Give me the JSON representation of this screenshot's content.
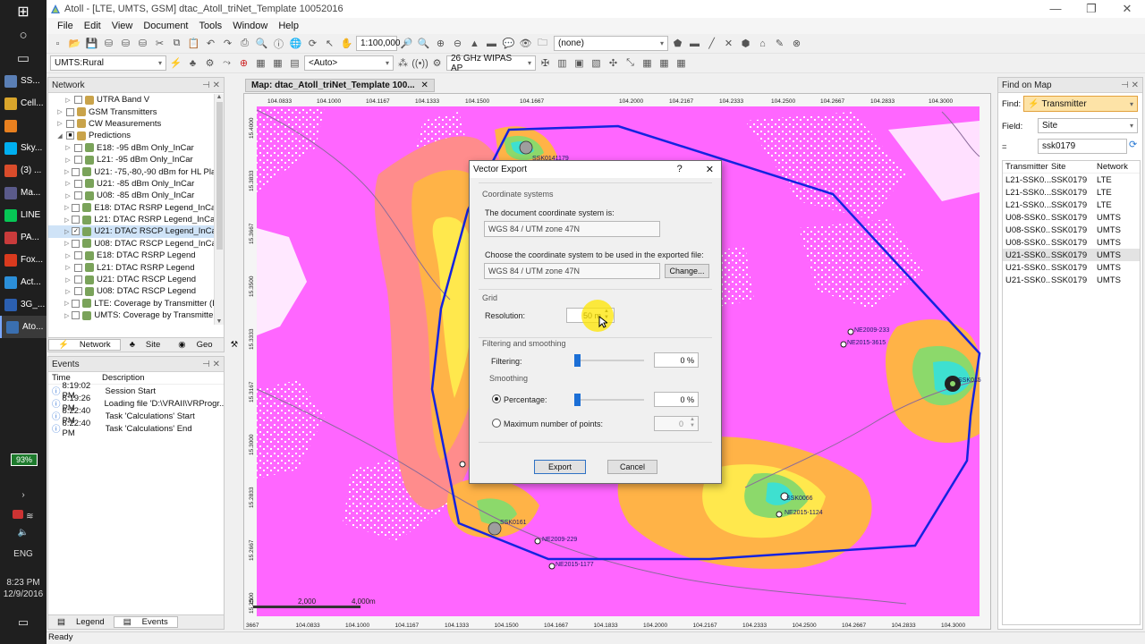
{
  "window": {
    "title": "Atoll - [LTE, UMTS, GSM] dtac_Atoll_triNet_Template 10052016"
  },
  "menu": [
    "File",
    "Edit",
    "View",
    "Document",
    "Tools",
    "Window",
    "Help"
  ],
  "toolbar1": {
    "scale": "1:100,000",
    "layer": "(none)"
  },
  "toolbar2": {
    "environment": "UMTS:Rural",
    "auto": "<Auto>",
    "frequency": "26 GHz WIPAS AP"
  },
  "taskbar": {
    "apps": [
      {
        "label": "SS...",
        "color": "#5a7fb5"
      },
      {
        "label": "Cell...",
        "color": "#d9a52b"
      },
      {
        "label": "",
        "color": "#e8801f"
      },
      {
        "label": "Sky...",
        "color": "#00aff0"
      },
      {
        "label": "(3) ...",
        "color": "#d94c2b"
      },
      {
        "label": "Ma...",
        "color": "#5a5a8a"
      },
      {
        "label": "LINE",
        "color": "#06c755"
      },
      {
        "label": "PA...",
        "color": "#c93b3b"
      },
      {
        "label": "Fox...",
        "color": "#d93a1e"
      },
      {
        "label": "Act...",
        "color": "#2b8fd9"
      },
      {
        "label": "3G_...",
        "color": "#2b5fb0"
      },
      {
        "label": "Ato...",
        "color": "#3a6fb0"
      }
    ],
    "battery": "93%",
    "lang": "ENG",
    "time": "8:23 PM",
    "date": "12/9/2016"
  },
  "network_panel": {
    "title": "Network",
    "items": [
      {
        "label": "UTRA Band V",
        "indent": 2,
        "check": "",
        "icon": "#c9a34a"
      },
      {
        "label": "GSM Transmitters",
        "indent": 1,
        "check": "",
        "icon": "#c9a34a"
      },
      {
        "label": "CW Measurements",
        "indent": 1,
        "check": "",
        "icon": "#c9a34a"
      },
      {
        "label": "Predictions",
        "indent": 1,
        "check": "■",
        "icon": "#c9a34a"
      },
      {
        "label": "E18: -95 dBm Only_InCar",
        "indent": 2,
        "check": "",
        "icon": "#7aa35a"
      },
      {
        "label": "L21: -95 dBm Only_InCar",
        "indent": 2,
        "check": "",
        "icon": "#7aa35a"
      },
      {
        "label": "U21: -75,-80,-90 dBm for HL Planr",
        "indent": 2,
        "check": "",
        "icon": "#7aa35a"
      },
      {
        "label": "U21: -85 dBm Only_InCar",
        "indent": 2,
        "check": "",
        "icon": "#7aa35a"
      },
      {
        "label": "U08: -85 dBm Only_InCar",
        "indent": 2,
        "check": "",
        "icon": "#7aa35a"
      },
      {
        "label": "E18: DTAC RSRP Legend_InCar",
        "indent": 2,
        "check": "",
        "icon": "#7aa35a"
      },
      {
        "label": "L21: DTAC RSRP Legend_InCar",
        "indent": 2,
        "check": "",
        "icon": "#7aa35a"
      },
      {
        "label": "U21: DTAC RSCP Legend_InCar",
        "indent": 2,
        "check": "✓",
        "icon": "#7aa35a",
        "selected": true
      },
      {
        "label": "U08: DTAC RSCP Legend_InCar",
        "indent": 2,
        "check": "",
        "icon": "#7aa35a"
      },
      {
        "label": "E18: DTAC RSRP Legend",
        "indent": 2,
        "check": "",
        "icon": "#7aa35a"
      },
      {
        "label": "L21: DTAC RSRP Legend",
        "indent": 2,
        "check": "",
        "icon": "#7aa35a"
      },
      {
        "label": "U21: DTAC RSCP Legend",
        "indent": 2,
        "check": "",
        "icon": "#7aa35a"
      },
      {
        "label": "U08: DTAC RSCP Legend",
        "indent": 2,
        "check": "",
        "icon": "#7aa35a"
      },
      {
        "label": "LTE: Coverage by Transmitter (DL)",
        "indent": 2,
        "check": "",
        "icon": "#7aa35a"
      },
      {
        "label": "UMTS: Coverage by Transmitter (I",
        "indent": 2,
        "check": "",
        "icon": "#7aa35a"
      }
    ],
    "tabs": [
      "Network",
      "Site",
      "Geo",
      "Parameters"
    ]
  },
  "events_panel": {
    "title": "Events",
    "col_time": "Time",
    "col_desc": "Description",
    "rows": [
      {
        "time": "8:19:02 PM",
        "desc": "Session Start"
      },
      {
        "time": "8:19:26 PM",
        "desc": "Loading file 'D:\\VRAII\\VRProgr..."
      },
      {
        "time": "8:22:40 PM",
        "desc": "Task 'Calculations' Start"
      },
      {
        "time": "8:22:40 PM",
        "desc": "Task 'Calculations' End"
      }
    ],
    "tabs": [
      "Legend",
      "Events"
    ]
  },
  "map": {
    "tab": "Map: dtac_Atoll_triNet_Template 100...",
    "top_ticks": [
      "104.0833",
      "104.1000",
      "104.1167",
      "104.1333",
      "104.1500",
      "104.1667",
      "104.2000",
      "104.2167",
      "104.2333",
      "104.2500",
      "104.2667",
      "104.2833",
      "104.3000"
    ],
    "bottom_ticks": [
      "3667",
      "104.0833",
      "104.1000",
      "104.1167",
      "104.1333",
      "104.1500",
      "104.1667",
      "104.1833",
      "104.2000",
      "104.2167",
      "104.2333",
      "104.2500",
      "104.2667",
      "104.2833",
      "104.3000"
    ],
    "left_ticks": [
      "15.4000",
      "15.3833",
      "15.3667",
      "15.3500",
      "15.3333",
      "15.3167",
      "15.3000",
      "15.2833",
      "15.2667",
      "15.2500"
    ],
    "scale": {
      "zero": "0",
      "mid": "2,000",
      "end": "4,000m"
    },
    "sites": [
      "SSK0141179",
      "SSK0066",
      "NE2015-1124",
      "SSK0161",
      "NE2009-229",
      "NE2015-1177",
      "NE2009-233",
      "NE2015-3615",
      "SSK015"
    ]
  },
  "dialog": {
    "title": "Vector Export",
    "help": "?",
    "close": "✕",
    "section_coord": "Coordinate systems",
    "doc_cs_label": "The document coordinate system is:",
    "doc_cs_value": "WGS 84 / UTM zone 47N",
    "export_cs_label": "Choose the coordinate system to be used in the exported file:",
    "export_cs_value": "WGS 84 / UTM zone 47N",
    "change": "Change...",
    "section_grid": "Grid",
    "resolution_label": "Resolution:",
    "resolution_value": "50",
    "resolution_unit": "m",
    "section_filter": "Filtering and smoothing",
    "filtering_label": "Filtering:",
    "filtering_value": "0",
    "percent": "%",
    "smoothing_label": "Smoothing",
    "percentage_label": "Percentage:",
    "percentage_value": "0",
    "max_points_label": "Maximum number of points:",
    "max_points_value": "0",
    "export": "Export",
    "cancel": "Cancel"
  },
  "find_panel": {
    "title": "Find on Map",
    "find_label": "Find:",
    "find_value": "Transmitter",
    "field_label": "Field:",
    "field_value": "Site",
    "eq_label": "=",
    "search_value": "ssk0179",
    "columns": [
      "Transmitter",
      "Site",
      "Network"
    ],
    "rows": [
      {
        "tx": "L21-SSK0...",
        "site": "SSK0179",
        "net": "LTE"
      },
      {
        "tx": "L21-SSK0...",
        "site": "SSK0179",
        "net": "LTE"
      },
      {
        "tx": "L21-SSK0...",
        "site": "SSK0179",
        "net": "LTE"
      },
      {
        "tx": "U08-SSK0...",
        "site": "SSK0179",
        "net": "UMTS"
      },
      {
        "tx": "U08-SSK0...",
        "site": "SSK0179",
        "net": "UMTS"
      },
      {
        "tx": "U08-SSK0...",
        "site": "SSK0179",
        "net": "UMTS"
      },
      {
        "tx": "U21-SSK0...",
        "site": "SSK0179",
        "net": "UMTS",
        "selected": true
      },
      {
        "tx": "U21-SSK0...",
        "site": "SSK0179",
        "net": "UMTS"
      },
      {
        "tx": "U21-SSK0...",
        "site": "SSK0179",
        "net": "UMTS"
      }
    ]
  },
  "status": "Ready"
}
